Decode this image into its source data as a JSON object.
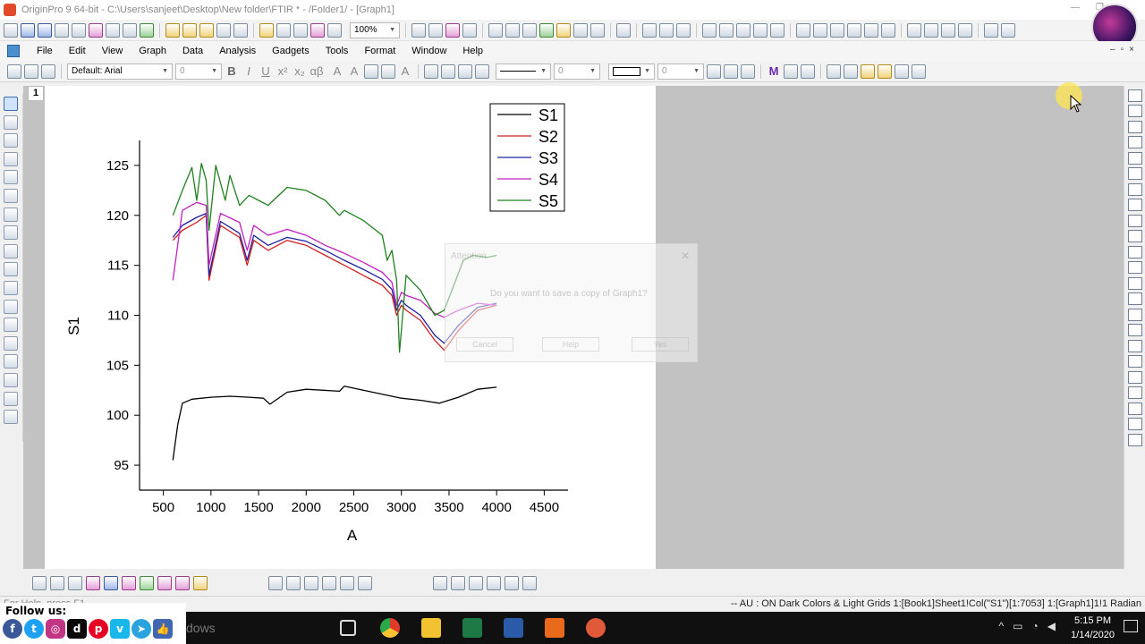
{
  "window": {
    "title": "OriginPro 9 64-bit - C:\\Users\\sanjeet\\Desktop\\New folder\\FTIR * - /Folder1/ - [Graph1]"
  },
  "toolbar": {
    "zoom": "100%"
  },
  "menu": [
    "File",
    "Edit",
    "View",
    "Graph",
    "Data",
    "Analysis",
    "Gadgets",
    "Tools",
    "Format",
    "Window",
    "Help"
  ],
  "format_toolbar": {
    "font_name": "Default: Arial",
    "font_size": "0",
    "line_width": "0",
    "border_width": "0",
    "pattern_value": "0"
  },
  "graph": {
    "layer_label": "1"
  },
  "chart_data": {
    "type": "line",
    "xlabel": "A",
    "ylabel": "S1",
    "xlim": [
      250,
      4750
    ],
    "ylim": [
      92.5,
      127.5
    ],
    "xticks": [
      500,
      1000,
      1500,
      2000,
      2500,
      3000,
      3500,
      4000,
      4500
    ],
    "yticks": [
      95,
      100,
      105,
      110,
      115,
      120,
      125
    ],
    "legend_position": "top-right",
    "grid": false,
    "series": [
      {
        "name": "S1",
        "color": "#000000",
        "x": [
          600,
          650,
          700,
          800,
          1000,
          1200,
          1400,
          1550,
          1620,
          1800,
          2000,
          2350,
          2400,
          2600,
          2800,
          3000,
          3200,
          3400,
          3600,
          3800,
          4000
        ],
        "y": [
          95.5,
          99.0,
          101.2,
          101.6,
          101.8,
          101.9,
          101.8,
          101.7,
          101.1,
          102.3,
          102.6,
          102.4,
          102.9,
          102.5,
          102.1,
          101.7,
          101.5,
          101.2,
          101.8,
          102.6,
          102.8
        ]
      },
      {
        "name": "S2",
        "color": "#d02020",
        "x": [
          600,
          700,
          850,
          950,
          980,
          1100,
          1300,
          1380,
          1450,
          1600,
          1800,
          2000,
          2200,
          2400,
          2600,
          2800,
          2900,
          2950,
          3000,
          3050,
          3200,
          3350,
          3450,
          3600,
          3800,
          4000
        ],
        "y": [
          117.5,
          118.5,
          119.3,
          120.0,
          113.5,
          119.0,
          117.8,
          115.0,
          117.5,
          116.5,
          117.5,
          117.0,
          116.0,
          115.0,
          114.0,
          113.0,
          112.0,
          110.0,
          111.0,
          110.5,
          109.5,
          107.5,
          106.5,
          108.5,
          110.5,
          111.0
        ]
      },
      {
        "name": "S3",
        "color": "#2020a0",
        "x": [
          600,
          700,
          850,
          950,
          980,
          1100,
          1300,
          1380,
          1450,
          1600,
          1800,
          2000,
          2200,
          2400,
          2600,
          2800,
          2900,
          2950,
          3000,
          3050,
          3200,
          3350,
          3450,
          3600,
          3800,
          4000
        ],
        "y": [
          117.8,
          119.0,
          119.8,
          120.2,
          114.0,
          119.4,
          118.2,
          115.5,
          118.0,
          117.0,
          117.8,
          117.4,
          116.5,
          115.5,
          114.6,
          113.6,
          112.6,
          110.5,
          111.5,
          111.0,
          110.0,
          108.0,
          107.2,
          109.0,
          110.8,
          111.2
        ]
      },
      {
        "name": "S4",
        "color": "#c020c0",
        "x": [
          600,
          700,
          850,
          950,
          980,
          1100,
          1300,
          1380,
          1450,
          1600,
          1800,
          2000,
          2200,
          2400,
          2600,
          2800,
          2900,
          2950,
          3000,
          3050,
          3200,
          3350,
          3450,
          3600,
          3800,
          4000
        ],
        "y": [
          113.5,
          120.5,
          121.3,
          121.0,
          115.0,
          120.2,
          119.3,
          116.5,
          119.0,
          118.0,
          118.6,
          118.0,
          117.0,
          116.2,
          115.3,
          114.3,
          113.3,
          111.0,
          112.3,
          112.0,
          111.5,
          110.2,
          109.8,
          110.5,
          111.2,
          111.0
        ]
      },
      {
        "name": "S5",
        "color": "#208020",
        "x": [
          600,
          700,
          800,
          850,
          900,
          950,
          980,
          1050,
          1150,
          1200,
          1300,
          1400,
          1500,
          1600,
          1800,
          2000,
          2200,
          2350,
          2400,
          2600,
          2800,
          2850,
          2900,
          2950,
          2980,
          3050,
          3200,
          3350,
          3450,
          3550,
          3650,
          3750,
          3900,
          4000
        ],
        "y": [
          120.0,
          122.5,
          124.8,
          121.5,
          125.2,
          123.5,
          118.5,
          125.0,
          121.5,
          124.0,
          121.0,
          122.0,
          121.5,
          121.0,
          122.8,
          122.5,
          121.5,
          120.0,
          120.5,
          119.5,
          118.0,
          115.5,
          116.5,
          113.5,
          106.3,
          114.0,
          112.5,
          110.0,
          110.5,
          113.0,
          115.5,
          116.0,
          115.8,
          116.0
        ]
      }
    ]
  },
  "dialog": {
    "title": "Attention",
    "message": "Do you want to save a copy of Graph1?",
    "buttons": [
      "Cancel",
      "Help",
      "Yes"
    ]
  },
  "statusbar": {
    "left": "For Help, press F1",
    "right": "-- AU : ON  Dark Colors & Light Grids  1:[Book1]Sheet1!Col(\"S1\")[1:7053]  1:[Graph1]1!1  Radian"
  },
  "taskbar": {
    "search_ghost": "dows",
    "time": "5:15 PM",
    "date": "1/14/2020"
  },
  "social": {
    "label": "Follow us:",
    "icons": [
      "facebook-icon",
      "twitter-icon",
      "instagram-icon",
      "dailymotion-icon",
      "pinterest-icon",
      "vimeo-icon",
      "telegram-icon",
      "like-icon"
    ]
  }
}
